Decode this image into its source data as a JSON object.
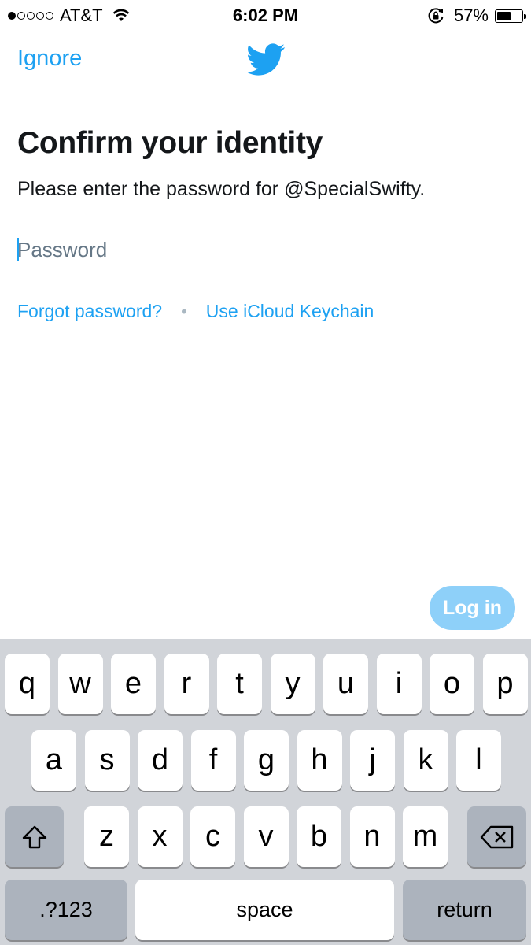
{
  "status_bar": {
    "carrier": "AT&T",
    "time": "6:02 PM",
    "battery": "57%",
    "battery_level": 0.57
  },
  "nav": {
    "ignore_label": "Ignore"
  },
  "main": {
    "title": "Confirm your identity",
    "subtitle": "Please enter the password for @SpecialSwifty.",
    "password_placeholder": "Password",
    "forgot_label": "Forgot password?",
    "separator": "•",
    "icloud_label": "Use iCloud Keychain"
  },
  "footer": {
    "login_label": "Log in"
  },
  "keyboard": {
    "row1": [
      "q",
      "w",
      "e",
      "r",
      "t",
      "y",
      "u",
      "i",
      "o",
      "p"
    ],
    "row2": [
      "a",
      "s",
      "d",
      "f",
      "g",
      "h",
      "j",
      "k",
      "l"
    ],
    "row3": [
      "z",
      "x",
      "c",
      "v",
      "b",
      "n",
      "m"
    ],
    "numbers_label": ".?123",
    "space_label": "space",
    "return_label": "return"
  },
  "colors": {
    "accent": "#1da1f2",
    "login_disabled": "#8ed0f9",
    "keyboard_bg": "#d1d4d9"
  }
}
